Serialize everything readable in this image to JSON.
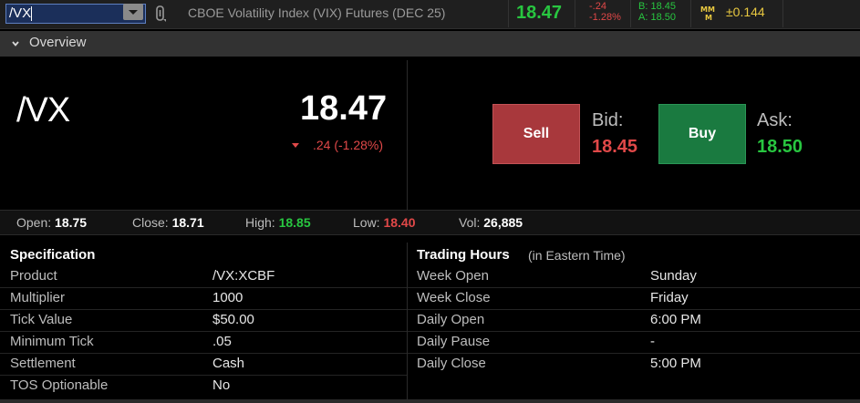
{
  "toolbar": {
    "symbol_value": "/VX",
    "instrument_name": "CBOE Volatility Index (VIX) Futures (DEC 25)",
    "last": "18.47",
    "net_change": "-.24",
    "pct_change": "-1.28%",
    "bid_text": "B: 18.45",
    "ask_text": "A: 18.50",
    "mm_text": "±0.144"
  },
  "overview": {
    "title": "Overview",
    "symbol": "/VX",
    "last": "18.47",
    "change_text": ".24 (-1.28%)",
    "sell_label": "Sell",
    "buy_label": "Buy",
    "bid_label": "Bid:",
    "bid_value": "18.45",
    "ask_label": "Ask:",
    "ask_value": "18.50"
  },
  "stats": {
    "open_label": "Open:",
    "open_value": "18.75",
    "close_label": "Close:",
    "close_value": "18.71",
    "high_label": "High:",
    "high_value": "18.85",
    "low_label": "Low:",
    "low_value": "18.40",
    "vol_label": "Vol:",
    "vol_value": "26,885"
  },
  "specification": {
    "title": "Specification",
    "rows": [
      {
        "label": "Product",
        "value": "/VX:XCBF"
      },
      {
        "label": "Multiplier",
        "value": "1000"
      },
      {
        "label": "Tick Value",
        "value": "$50.00"
      },
      {
        "label": "Minimum Tick",
        "value": ".05"
      },
      {
        "label": "Settlement",
        "value": "Cash"
      },
      {
        "label": "TOS Optionable",
        "value": "No"
      }
    ]
  },
  "trading_hours": {
    "title": "Trading Hours",
    "subtitle": "(in Eastern Time)",
    "rows": [
      {
        "label": "Week Open",
        "value": "Sunday"
      },
      {
        "label": "Week Close",
        "value": "Friday"
      },
      {
        "label": "Daily Open",
        "value": "6:00 PM"
      },
      {
        "label": "Daily Pause",
        "value": "-"
      },
      {
        "label": "Daily Close",
        "value": "5:00 PM"
      }
    ]
  },
  "colors": {
    "up": "#28c640",
    "down": "#e04848",
    "sell": "#a8383c",
    "buy": "#1a7a40"
  },
  "icons": [
    "chevron-down-icon",
    "link-icon",
    "mm-icon",
    "dropdown-arrow-icon",
    "down-arrow-icon"
  ]
}
